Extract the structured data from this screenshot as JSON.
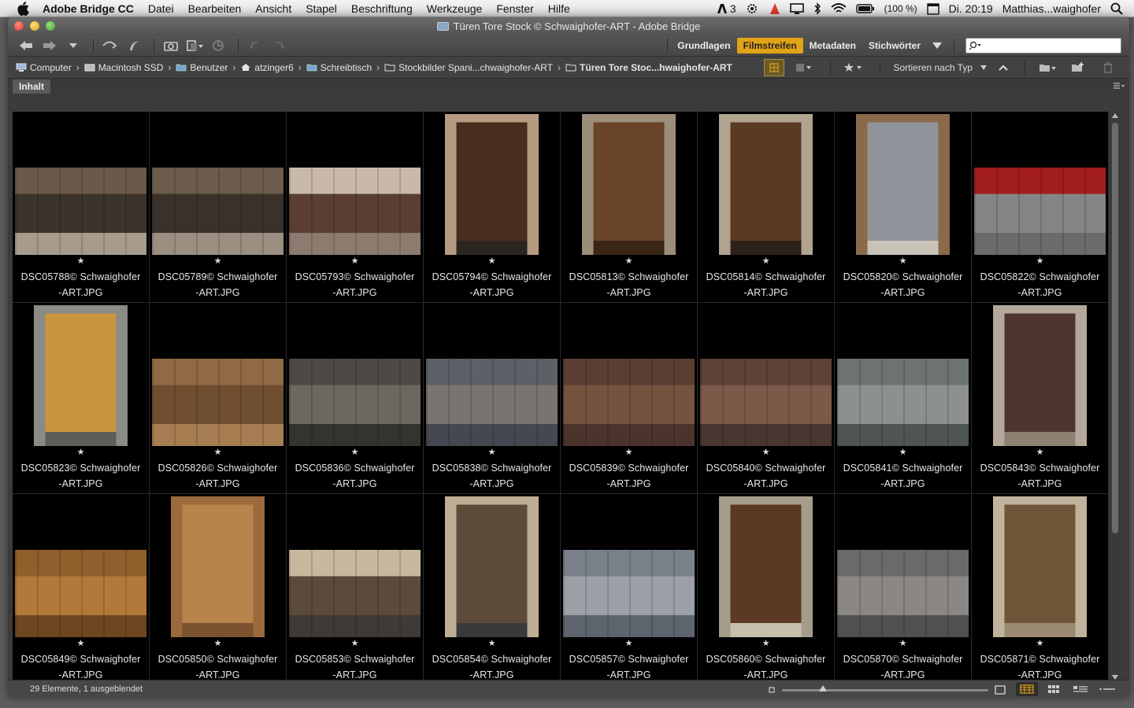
{
  "menubar": {
    "app_name": "Adobe Bridge CC",
    "menus": [
      "Datei",
      "Bearbeiten",
      "Ansicht",
      "Stapel",
      "Beschriftung",
      "Werkzeuge",
      "Fenster",
      "Hilfe"
    ],
    "adobe_count": "3",
    "battery": "(100 %)",
    "clock": "Di. 20:19",
    "user": "Matthias...waighofer"
  },
  "window": {
    "title": "Türen Tore Stock © Schwaighofer-ART - Adobe Bridge"
  },
  "workspaces": {
    "tabs": [
      "Grundlagen",
      "Filmstreifen",
      "Metadaten",
      "Stichwörter"
    ],
    "active": "Filmstreifen",
    "accent": "#e1a317"
  },
  "search": {
    "placeholder": "",
    "value": ""
  },
  "path": {
    "crumbs": [
      "Computer",
      "Macintosh SSD",
      "Benutzer",
      "atzinger6",
      "Schreibtisch",
      "Stockbilder Spani...chwaighofer-ART",
      "Türen Tore Stoc...hwaighofer-ART"
    ],
    "sort_label": "Sortieren nach Typ"
  },
  "panel": {
    "tab_label": "Inhalt"
  },
  "items": [
    {
      "line1": "DSC05788© Schwaighofer",
      "line2": "-ART.JPG",
      "star": "★",
      "orient": "landscape",
      "colors": [
        "#6b5a4a",
        "#3b332c",
        "#a79c8c"
      ]
    },
    {
      "line1": "DSC05789© Schwaighofer",
      "line2": "-ART.JPG",
      "star": "★",
      "orient": "landscape",
      "colors": [
        "#6b5c4c",
        "#3a322a",
        "#9a8f80"
      ]
    },
    {
      "line1": "DSC05793© Schwaighofer",
      "line2": "-ART.JPG",
      "star": "★",
      "orient": "landscape",
      "colors": [
        "#c9b9aa",
        "#5a3d33",
        "#8e7b70"
      ]
    },
    {
      "line1": "DSC05794© Schwaighofer",
      "line2": "-ART.JPG",
      "star": "★",
      "orient": "portrait",
      "colors": [
        "#b59a82",
        "#4a2c1d",
        "#2a2520"
      ]
    },
    {
      "line1": "DSC05813© Schwaighofer",
      "line2": "-ART.JPG",
      "star": "★",
      "orient": "portrait",
      "colors": [
        "#9c8c7a",
        "#6a4428",
        "#3a2616"
      ]
    },
    {
      "line1": "DSC05814© Schwaighofer",
      "line2": "-ART.JPG",
      "star": "★",
      "orient": "portrait",
      "colors": [
        "#b0a390",
        "#5a3a22",
        "#2c2118"
      ]
    },
    {
      "line1": "DSC05820© Schwaighofer",
      "line2": "-ART.JPG",
      "star": "★",
      "orient": "portrait",
      "colors": [
        "#8a6a4a",
        "#8f949a",
        "#c9c3b8"
      ]
    },
    {
      "line1": "DSC05822© Schwaighofer",
      "line2": "-ART.JPG",
      "star": "★",
      "orient": "landscape",
      "colors": [
        "#a21d1d",
        "#858585",
        "#6b6b6b"
      ]
    },
    {
      "line1": "DSC05823© Schwaighofer",
      "line2": "-ART.JPG",
      "star": "★",
      "orient": "portrait",
      "colors": [
        "#8a8a86",
        "#c8953e",
        "#5d5d5a"
      ]
    },
    {
      "line1": "DSC05826© Schwaighofer",
      "line2": "-ART.JPG",
      "star": "★",
      "orient": "landscape",
      "colors": [
        "#8f6a44",
        "#6f4f30",
        "#a77d52"
      ]
    },
    {
      "line1": "DSC05836© Schwaighofer",
      "line2": "-ART.JPG",
      "star": "★",
      "orient": "landscape",
      "colors": [
        "#4d4a45",
        "#6c675f",
        "#35332f"
      ]
    },
    {
      "line1": "DSC05838© Schwaighofer",
      "line2": "-ART.JPG",
      "star": "★",
      "orient": "landscape",
      "colors": [
        "#5d6066",
        "#7a7470",
        "#454850"
      ]
    },
    {
      "line1": "DSC05839© Schwaighofer",
      "line2": "-ART.JPG",
      "star": "★",
      "orient": "landscape",
      "colors": [
        "#5a3e34",
        "#74533f",
        "#4a342c"
      ]
    },
    {
      "line1": "DSC05840© Schwaighofer",
      "line2": "-ART.JPG",
      "star": "★",
      "orient": "landscape",
      "colors": [
        "#5d4238",
        "#7a5a48",
        "#4a3530"
      ]
    },
    {
      "line1": "DSC05841© Schwaighofer",
      "line2": "-ART.JPG",
      "star": "★",
      "orient": "landscape",
      "colors": [
        "#6c7370",
        "#8c918e",
        "#4f5553"
      ]
    },
    {
      "line1": "DSC05843© Schwaighofer",
      "line2": "-ART.JPG",
      "star": "★",
      "orient": "portrait",
      "colors": [
        "#b3a899",
        "#4e3530",
        "#8c8173"
      ]
    },
    {
      "line1": "DSC05849© Schwaighofer",
      "line2": "-ART.JPG",
      "star": "★",
      "orient": "landscape",
      "colors": [
        "#8f5f2c",
        "#b27a3a",
        "#6e4720"
      ]
    },
    {
      "line1": "DSC05850© Schwaighofer",
      "line2": "-ART.JPG",
      "star": "★",
      "orient": "portrait",
      "colors": [
        "#9a6a3c",
        "#b9834c",
        "#7a5230"
      ]
    },
    {
      "line1": "DSC05853© Schwaighofer",
      "line2": "-ART.JPG",
      "star": "★",
      "orient": "landscape",
      "colors": [
        "#c8b8a0",
        "#5c4a3a",
        "#3f3a36"
      ]
    },
    {
      "line1": "DSC05854© Schwaighofer",
      "line2": "-ART.JPG",
      "star": "★",
      "orient": "portrait",
      "colors": [
        "#bfae96",
        "#5e4a38",
        "#3b3a3a"
      ]
    },
    {
      "line1": "DSC05857© Schwaighofer",
      "line2": "-ART.JPG",
      "star": "★",
      "orient": "landscape",
      "colors": [
        "#7a818a",
        "#9ba0a6",
        "#5d646d"
      ]
    },
    {
      "line1": "DSC05860© Schwaighofer",
      "line2": "-ART.JPG",
      "star": "★",
      "orient": "portrait",
      "colors": [
        "#a69c8a",
        "#5a3a22",
        "#c6bfae"
      ]
    },
    {
      "line1": "DSC05870© Schwaighofer",
      "line2": "-ART.JPG",
      "star": "★",
      "orient": "landscape",
      "colors": [
        "#6c6a68",
        "#8a8784",
        "#52504e"
      ]
    },
    {
      "line1": "DSC05871© Schwaighofer",
      "line2": "-ART.JPG",
      "star": "★",
      "orient": "portrait",
      "colors": [
        "#c2b39c",
        "#6e5538",
        "#9b8a72"
      ]
    }
  ],
  "status": {
    "text": "29 Elemente, 1 ausgeblendet",
    "thumb_size_fraction": 0.2
  },
  "scroll": {
    "position_fraction": 0.0,
    "visible_fraction": 0.72
  }
}
